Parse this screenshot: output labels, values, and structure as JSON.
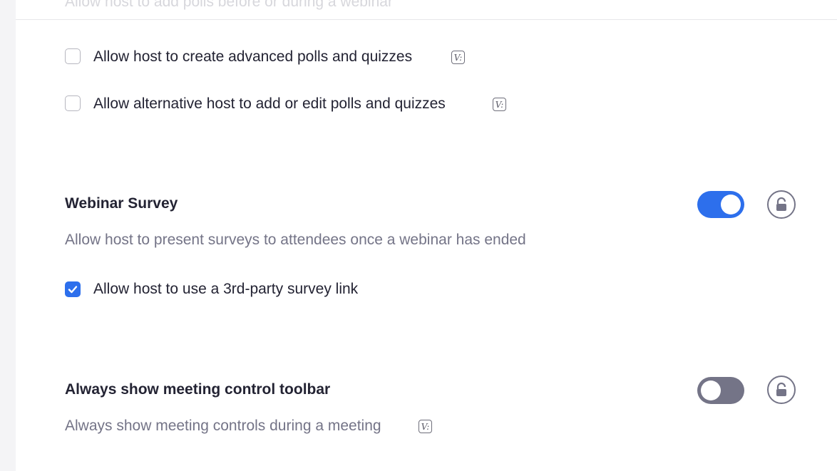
{
  "header": {
    "faded_text": "Allow host to add polls before or during a webinar"
  },
  "polls": {
    "options": [
      {
        "label": "Allow host to create advanced polls and quizzes",
        "checked": false,
        "icon": "v-badge-icon"
      },
      {
        "label": "Allow alternative host to add or edit polls and quizzes",
        "checked": false,
        "icon": "v-badge-icon"
      }
    ]
  },
  "webinar_survey": {
    "title": "Webinar Survey",
    "description": "Allow host to present surveys to attendees once a webinar has ended",
    "enabled": true,
    "lock_icon": "unlocked-lock-icon",
    "option": {
      "label": "Allow host to use a 3rd-party survey link",
      "checked": true
    }
  },
  "meeting_toolbar": {
    "title": "Always show meeting control toolbar",
    "description": "Always show meeting controls during a meeting",
    "enabled": false,
    "lock_icon": "unlocked-lock-icon",
    "desc_icon": "v-badge-icon"
  },
  "colors": {
    "accent": "#2d6fec",
    "toggle_off": "#747487",
    "text_primary": "#232333",
    "text_secondary": "#747487"
  }
}
